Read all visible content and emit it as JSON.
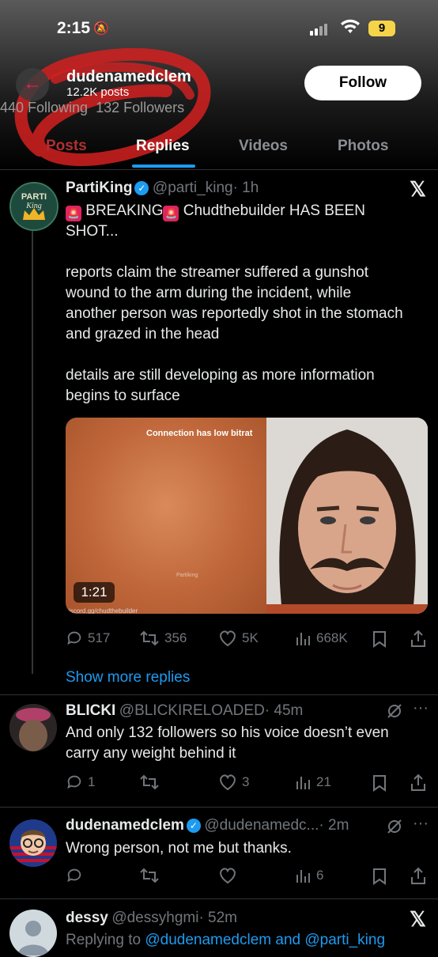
{
  "status_bar": {
    "time": "2:15",
    "battery": "9"
  },
  "profile_header": {
    "name": "dudenamedclem",
    "posts": "12.2K posts",
    "follow_label": "Follow",
    "following": "440 Following",
    "followers": "132 Followers"
  },
  "tabs": [
    {
      "label": "Posts",
      "active": false
    },
    {
      "label": "Replies",
      "active": true
    },
    {
      "label": "Videos",
      "active": false
    },
    {
      "label": "Photos",
      "active": false
    }
  ],
  "main_tweet": {
    "display_name": "PartiKing",
    "handle": "@parti_king",
    "time": "· 1h",
    "line1_a": "BREAKING",
    "line1_b": "Chudthebuilder HAS BEEN SHOT...",
    "para2": "reports claim the streamer suffered a gunshot wound to the arm during the incident, while another person was reportedly shot in the stomach and grazed in the head",
    "para3": "details are still developing as more information begins to surface",
    "media": {
      "overlay_text": "Connection has low bitrat",
      "watermark": "Partiking",
      "duration": "1:21",
      "url_fragment": "iscord.gg/chudthebuilder"
    },
    "stats": {
      "replies": "517",
      "reposts": "356",
      "likes": "5K",
      "views": "668K"
    }
  },
  "show_more": "Show more replies",
  "reply1": {
    "display_name": "BLICKI",
    "handle": "@BLICKIRELOADED",
    "time": "· 45m",
    "text": "And only 132 followers so his voice doesn’t even carry any weight behind it",
    "stats": {
      "replies": "1",
      "reposts": "",
      "likes": "3",
      "views": "21"
    }
  },
  "reply2": {
    "display_name": "dudenamedclem",
    "handle": "@dudenamedc...",
    "time": "· 2m",
    "text": "Wrong person, not me but thanks.",
    "stats": {
      "views": "6"
    }
  },
  "reply3": {
    "display_name": "dessy",
    "handle": "@dessyhgmi",
    "time": "· 52m",
    "replying_prefix": "Replying to ",
    "replying_to": "@dudenamedclem and @parti_king"
  },
  "colors": {
    "accent": "#1d9bf0",
    "muted": "#71767b",
    "background": "#000000"
  }
}
